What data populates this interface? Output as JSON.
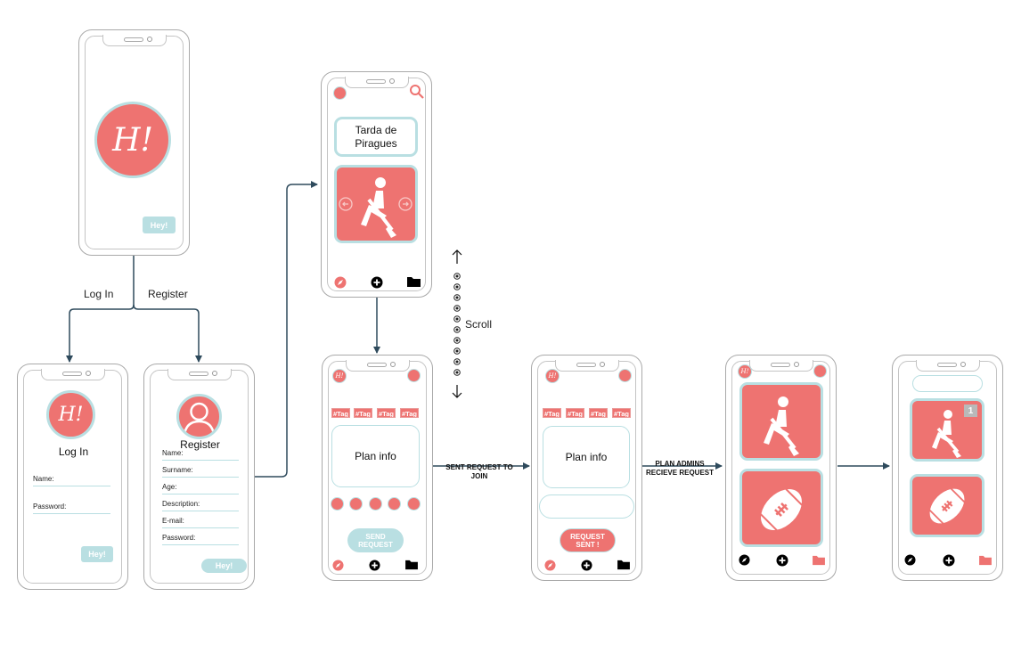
{
  "logo_text": "H!",
  "hey_label": "Hey!",
  "flow": {
    "login_label": "Log In",
    "register_label": "Register",
    "scroll_label": "Scroll",
    "sent_request_label": "SENT REQUEST TO JOIN",
    "admins_label": "PLAN ADMINS RECIEVE REQUEST"
  },
  "login_screen": {
    "title": "Log In",
    "fields": [
      "Name:",
      "Password:"
    ]
  },
  "register_screen": {
    "title": "Register",
    "fields": [
      "Name:",
      "Surname:",
      "Age:",
      "Description:",
      "E-mail:",
      "Password:"
    ]
  },
  "plan_screen": {
    "title": "Tarda de Piragues"
  },
  "detail_screen": {
    "tags": [
      "#Tag",
      "#Tag",
      "#Tag",
      "#Tag"
    ],
    "plan_info": "Plan info",
    "send_request": "SEND REQUEST"
  },
  "sent_screen": {
    "plan_info": "Plan info",
    "request_sent": "REQUEST SENT !"
  },
  "admin_screen": {
    "badge_count": "1"
  },
  "colors": {
    "coral": "#ee7371",
    "teal": "#b9dfe2",
    "arrow": "#2e4a5c"
  }
}
